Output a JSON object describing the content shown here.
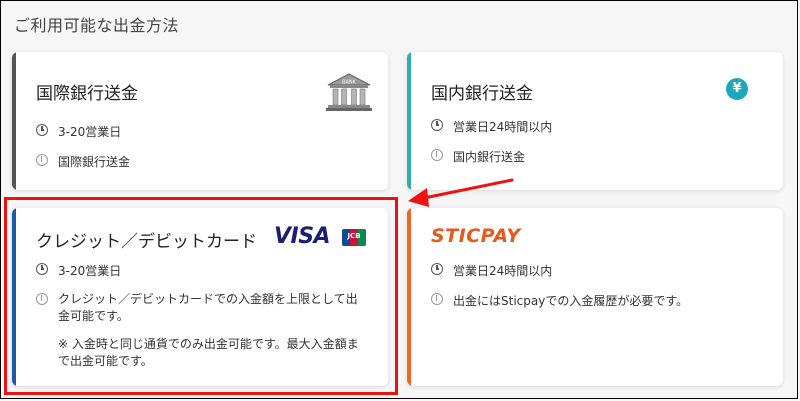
{
  "heading": "ご利用可能な出金方法",
  "colors": {
    "highlight": "#ee1111",
    "arrow": "#ee1111",
    "stripe_intl": "#555555",
    "stripe_domestic": "#2ab0b5",
    "stripe_card": "#1c5aa8",
    "stripe_sticpay": "#f26522",
    "yen_badge": "#1ca8b8",
    "visa": "#1a1f71"
  },
  "cards": [
    {
      "title": "国際銀行送金",
      "time": "3-20営業日",
      "note": "国際銀行送金",
      "icon": "bank-icon"
    },
    {
      "title": "国内銀行送金",
      "time": "営業日24時間以内",
      "note": "国内銀行送金",
      "icon": "yen-icon",
      "icon_text": "¥"
    },
    {
      "title": "クレジット／デビットカード",
      "time": "3-20営業日",
      "note_lines": [
        "クレジット／デビットカードでの入金額を上限として出",
        "金可能です。"
      ],
      "remark_lines": [
        "※ 入金時と同じ通貨でのみ出金可能です。最大入金額ま",
        "で出金可能です。"
      ],
      "logos": {
        "visa": "VISA",
        "jcb": "JCB"
      }
    },
    {
      "title": "STICPAY",
      "time": "営業日24時間以内",
      "note": "出金にはSticpayでの入金履歴が必要です。"
    }
  ],
  "bank_label": "BANK"
}
